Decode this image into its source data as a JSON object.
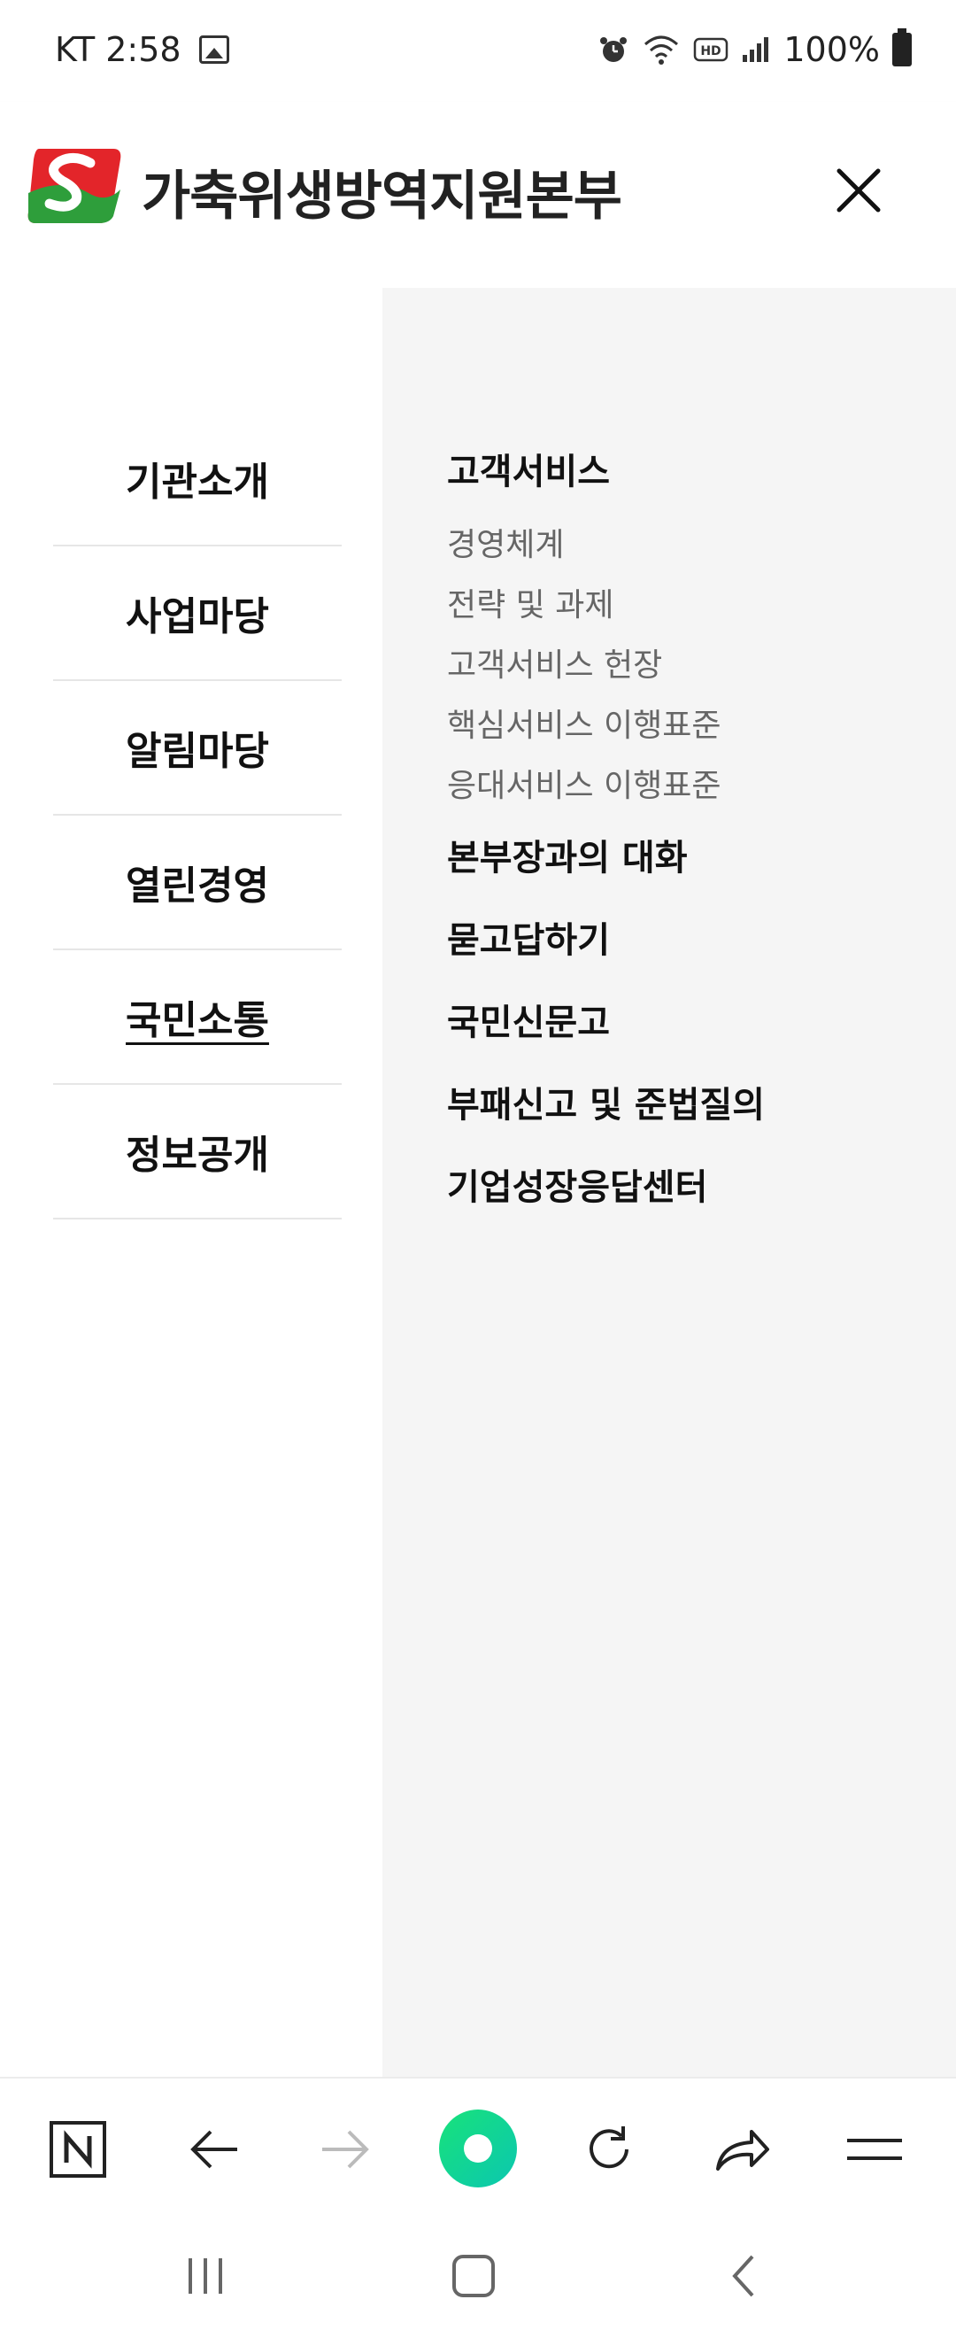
{
  "status": {
    "carrier_time": "KT 2:58",
    "battery": "100%"
  },
  "header": {
    "org_name": "가축위생방역지원본부",
    "logo": "shield-s-logo",
    "close_icon": "close-icon"
  },
  "categories": [
    {
      "label": "기관소개",
      "active": false
    },
    {
      "label": "사업마당",
      "active": false
    },
    {
      "label": "알림마당",
      "active": false
    },
    {
      "label": "열린경영",
      "active": false
    },
    {
      "label": "국민소통",
      "active": true
    },
    {
      "label": "정보공개",
      "active": false
    }
  ],
  "submenu": {
    "customer_service": {
      "label": "고객서비스",
      "children": [
        "경영체계",
        "전략 및 과제",
        "고객서비스 헌장",
        "핵심서비스 이행표준",
        "응대서비스 이행표준"
      ]
    },
    "others": [
      "본부장과의 대화",
      "묻고답하기",
      "국민신문고",
      "부패신고 및 준법질의",
      "기업성장응답센터"
    ]
  },
  "browser_toolbar": {
    "icons": [
      "naver-n-icon",
      "back-arrow-icon",
      "forward-arrow-icon",
      "home-dot-icon",
      "refresh-icon",
      "share-icon",
      "menu-icon"
    ]
  },
  "colors": {
    "logo_red": "#e3252a",
    "logo_green": "#2e9e3b",
    "home_green": "#18e27a"
  }
}
